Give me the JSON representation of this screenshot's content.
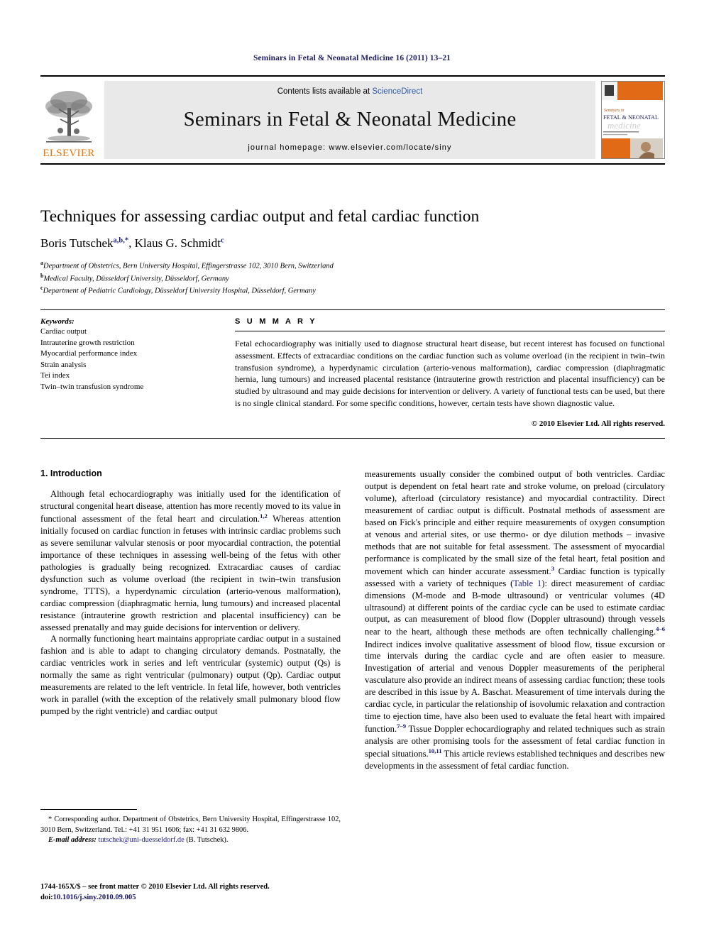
{
  "running_head": "Seminars in Fetal & Neonatal Medicine 16 (2011) 13–21",
  "masthead": {
    "contents_prefix": "Contents lists available at ",
    "contents_link": "ScienceDirect",
    "journal_title": "Seminars in Fetal & Neonatal Medicine",
    "homepage": "journal homepage: www.elsevier.com/locate/siny",
    "publisher_name": "ELSEVIER",
    "cover_line_1": "Seminars in",
    "cover_line_2": "FETAL & NEONATAL",
    "cover_line_3": "medicine"
  },
  "article": {
    "title": "Techniques for assessing cardiac output and fetal cardiac function",
    "authors": [
      {
        "name": "Boris Tutschek",
        "marks": "a,b,*"
      },
      {
        "name": "Klaus G. Schmidt",
        "marks": "c"
      }
    ],
    "authors_plain": "Boris Tutschek a,b,*, Klaus G. Schmidt c",
    "affiliations": [
      {
        "mark": "a",
        "text": "Department of Obstetrics, Bern University Hospital, Effingerstrasse 102, 3010 Bern, Switzerland"
      },
      {
        "mark": "b",
        "text": "Medical Faculty, Düsseldorf University, Düsseldorf, Germany"
      },
      {
        "mark": "c",
        "text": "Department of Pediatric Cardiology, Düsseldorf University Hospital, Düsseldorf, Germany"
      }
    ]
  },
  "keywords": {
    "heading": "Keywords:",
    "items": [
      "Cardiac output",
      "Intrauterine growth restriction",
      "Myocardial performance index",
      "Strain analysis",
      "Tei index",
      "Twin–twin transfusion syndrome"
    ]
  },
  "summary": {
    "heading": "S U M M A R Y",
    "text": "Fetal echocardiography was initially used to diagnose structural heart disease, but recent interest has focused on functional assessment. Effects of extracardiac conditions on the cardiac function such as volume overload (in the recipient in twin–twin transfusion syndrome), a hyperdynamic circulation (arterio-venous malformation), cardiac compression (diaphragmatic hernia, lung tumours) and increased placental resistance (intrauterine growth restriction and placental insufficiency) can be studied by ultrasound and may guide decisions for intervention or delivery. A variety of functional tests can be used, but there is no single clinical standard. For some specific conditions, however, certain tests have shown diagnostic value.",
    "copyright": "© 2010 Elsevier Ltd. All rights reserved."
  },
  "body": {
    "section_number_title": "1. Introduction",
    "left_paragraphs": [
      "Although fetal echocardiography was initially used for the identification of structural congenital heart disease, attention has more recently moved to its value in functional assessment of the fetal heart and circulation.",
      "Whereas attention initially focused on cardiac function in fetuses with intrinsic cardiac problems such as severe semilunar valvular stenosis or poor myocardial contraction, the potential importance of these techniques in assessing well-being of the fetus with other pathologies is gradually being recognized. Extracardiac causes of cardiac dysfunction such as volume overload (the recipient in twin–twin transfusion syndrome, TTTS), a hyperdynamic circulation (arterio-venous malformation), cardiac compression (diaphragmatic hernia, lung tumours) and increased placental resistance (intrauterine growth restriction and placental insufficiency) can be assessed prenatally and may guide decisions for intervention or delivery.",
      "A normally functioning heart maintains appropriate cardiac output in a sustained fashion and is able to adapt to changing circulatory demands. Postnatally, the cardiac ventricles work in series and left ventricular (systemic) output (Qs) is normally the same as right ventricular (pulmonary) output (Qp). Cardiac output measurements are related to the left ventricle. In fetal life, however, both ventricles work in parallel (with the exception of the relatively small pulmonary blood flow pumped by the right ventricle) and cardiac output"
    ],
    "left_refs": {
      "ref_1_2": "1,2"
    },
    "right_paragraph_parts": {
      "p1_a": "measurements usually consider the combined output of both ventricles. Cardiac output is dependent on fetal heart rate and stroke volume, on preload (circulatory volume), afterload (circulatory resistance) and myocardial contractility. Direct measurement of cardiac output is difficult. Postnatal methods of assessment are based on Fick's principle and either require measurements of oxygen consumption at venous and arterial sites, or use thermo- or dye dilution methods – invasive methods that are not suitable for fetal assessment. The assessment of myocardial performance is complicated by the small size of the fetal heart, fetal position and movement which can hinder accurate assessment.",
      "ref_3": "3",
      "p1_b": " Cardiac function is typically assessed with a variety of techniques (",
      "table_link": "Table 1",
      "p1_c": "): direct measurement of cardiac dimensions (M-mode and B-mode ultrasound) or ventricular volumes (4D ultrasound) at different points of the cardiac cycle can be used to estimate cardiac output, as can measurement of blood flow (Doppler ultrasound) through vessels near to the heart, although these methods are often technically challenging.",
      "ref_4_6": "4–6",
      "p1_d": " Indirect indices involve qualitative assessment of blood flow, tissue excursion or time intervals during the cardiac cycle and are often easier to measure. Investigation of arterial and venous Doppler measurements of the peripheral vasculature also provide an indirect means of assessing cardiac function; these tools are described in this issue by A. Baschat. Measurement of time intervals during the cardiac cycle, in particular the relationship of isovolumic relaxation and contraction time to ejection time, have also been used to evaluate the fetal heart with impaired function.",
      "ref_7_9": "7–9",
      "p1_e": " Tissue Doppler echocardiography and related techniques such as strain analysis are other promising tools for the assessment of fetal cardiac function in special situations.",
      "ref_10_11": "10,11",
      "p1_f": " This article reviews established techniques and describes new developments in the assessment of fetal cardiac function."
    }
  },
  "footnote": {
    "corresponding": "* Corresponding author. Department of Obstetrics, Bern University Hospital, Effingerstrasse 102, 3010 Bern, Switzerland. Tel.: +41 31 951 1606; fax: +41 31 632 9806.",
    "email_label": "E-mail address:",
    "email": "tutschek@uni-duesseldorf.de",
    "email_owner": "(B. Tutschek)."
  },
  "imprint": {
    "line1": "1744-165X/$ – see front matter © 2010 Elsevier Ltd. All rights reserved.",
    "doi_label": "doi:",
    "doi": "10.1016/j.siny.2010.09.005"
  },
  "colors": {
    "running_head": "#1d1d66",
    "link": "#1d1d8c",
    "sciencedirect": "#2f57a8",
    "elsevier_orange": "#ec7404",
    "band_gray": "#e9e9e9"
  }
}
